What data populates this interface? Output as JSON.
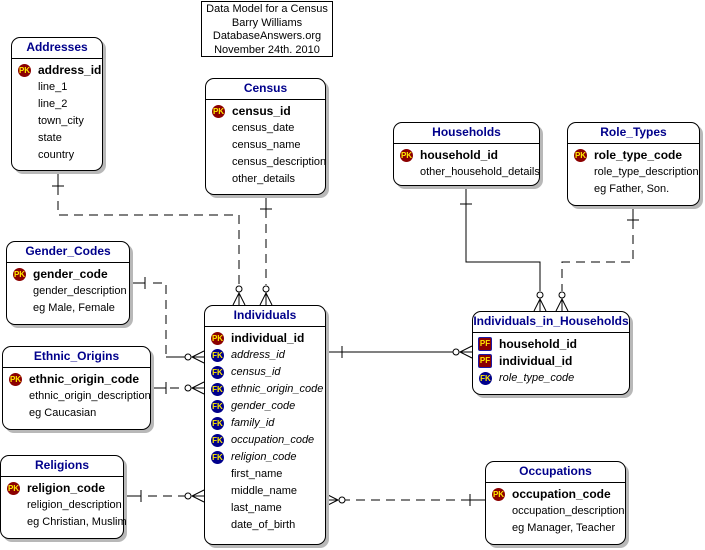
{
  "title_block": {
    "lines": [
      "Data Model for a Census",
      "Barry Williams",
      "DatabaseAnswers.org",
      "November 24th. 2010"
    ]
  },
  "key_badges": {
    "pk": "PK",
    "fk": "FK",
    "pf": "PF"
  },
  "entities": {
    "addresses": {
      "name": "Addresses",
      "attributes": [
        {
          "name": "address_id",
          "key": "pk"
        },
        {
          "name": "line_1",
          "key": ""
        },
        {
          "name": "line_2",
          "key": ""
        },
        {
          "name": "town_city",
          "key": ""
        },
        {
          "name": "state",
          "key": ""
        },
        {
          "name": "country",
          "key": ""
        }
      ]
    },
    "census": {
      "name": "Census",
      "attributes": [
        {
          "name": "census_id",
          "key": "pk"
        },
        {
          "name": "census_date",
          "key": ""
        },
        {
          "name": "census_name",
          "key": ""
        },
        {
          "name": "census_description",
          "key": ""
        },
        {
          "name": "other_details",
          "key": ""
        }
      ]
    },
    "households": {
      "name": "Households",
      "attributes": [
        {
          "name": "household_id",
          "key": "pk"
        },
        {
          "name": "other_household_details",
          "key": ""
        }
      ]
    },
    "role_types": {
      "name": "Role_Types",
      "attributes": [
        {
          "name": "role_type_code",
          "key": "pk"
        },
        {
          "name": "role_type_description",
          "key": ""
        },
        {
          "name": "eg Father, Son.",
          "key": ""
        }
      ]
    },
    "gender_codes": {
      "name": "Gender_Codes",
      "attributes": [
        {
          "name": "gender_code",
          "key": "pk"
        },
        {
          "name": "gender_description",
          "key": ""
        },
        {
          "name": "eg Male, Female",
          "key": ""
        }
      ]
    },
    "ethnic_origins": {
      "name": "Ethnic_Origins",
      "attributes": [
        {
          "name": "ethnic_origin_code",
          "key": "pk"
        },
        {
          "name": "ethnic_origin_description",
          "key": ""
        },
        {
          "name": "eg Caucasian",
          "key": ""
        }
      ]
    },
    "religions": {
      "name": "Religions",
      "attributes": [
        {
          "name": "religion_code",
          "key": "pk"
        },
        {
          "name": "religion_description",
          "key": ""
        },
        {
          "name": "eg Christian, Muslim",
          "key": ""
        }
      ]
    },
    "individuals": {
      "name": "Individuals",
      "attributes": [
        {
          "name": "individual_id",
          "key": "pk"
        },
        {
          "name": "address_id",
          "key": "fk"
        },
        {
          "name": "census_id",
          "key": "fk"
        },
        {
          "name": "ethnic_origin_code",
          "key": "fk"
        },
        {
          "name": "gender_code",
          "key": "fk"
        },
        {
          "name": "family_id",
          "key": "fk"
        },
        {
          "name": "occupation_code",
          "key": "fk"
        },
        {
          "name": "religion_code",
          "key": "fk"
        },
        {
          "name": "first_name",
          "key": ""
        },
        {
          "name": "middle_name",
          "key": ""
        },
        {
          "name": "last_name",
          "key": ""
        },
        {
          "name": "date_of_birth",
          "key": ""
        }
      ]
    },
    "individuals_in_households": {
      "name": "Individuals_in_Households",
      "attributes": [
        {
          "name": "household_id",
          "key": "pf"
        },
        {
          "name": "individual_id",
          "key": "pf"
        },
        {
          "name": "role_type_code",
          "key": "fk"
        }
      ]
    },
    "occupations": {
      "name": "Occupations",
      "attributes": [
        {
          "name": "occupation_code",
          "key": "pk"
        },
        {
          "name": "occupation_description",
          "key": ""
        },
        {
          "name": "eg Manager, Teacher",
          "key": ""
        }
      ]
    }
  },
  "relationships": [
    {
      "from": "Addresses",
      "to": "Individuals",
      "identifying": false,
      "cardinality": "one-to-zero-or-many"
    },
    {
      "from": "Census",
      "to": "Individuals",
      "identifying": false,
      "cardinality": "one-to-zero-or-many"
    },
    {
      "from": "Gender_Codes",
      "to": "Individuals",
      "identifying": false,
      "cardinality": "one-to-zero-or-many"
    },
    {
      "from": "Ethnic_Origins",
      "to": "Individuals",
      "identifying": false,
      "cardinality": "one-to-zero-or-many"
    },
    {
      "from": "Religions",
      "to": "Individuals",
      "identifying": false,
      "cardinality": "one-to-zero-or-many"
    },
    {
      "from": "Occupations",
      "to": "Individuals",
      "identifying": false,
      "cardinality": "one-to-zero-or-many"
    },
    {
      "from": "Individuals",
      "to": "Individuals_in_Households",
      "identifying": true,
      "cardinality": "one-to-zero-or-many"
    },
    {
      "from": "Households",
      "to": "Individuals_in_Households",
      "identifying": true,
      "cardinality": "one-to-zero-or-many"
    },
    {
      "from": "Role_Types",
      "to": "Individuals_in_Households",
      "identifying": false,
      "cardinality": "one-to-zero-or-many"
    }
  ]
}
